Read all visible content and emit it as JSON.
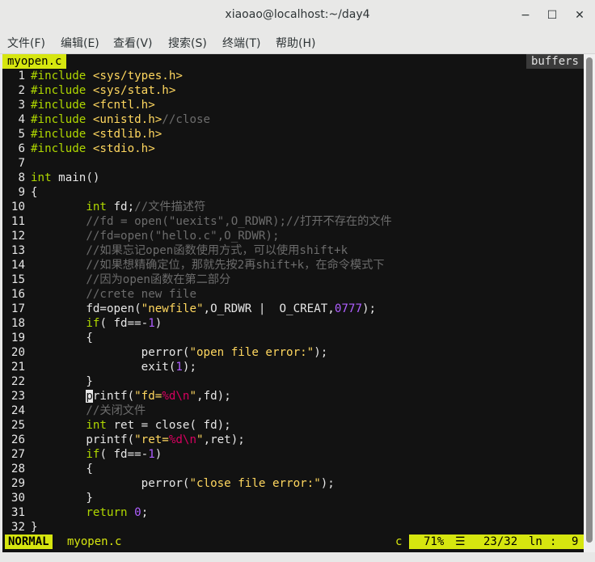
{
  "window": {
    "title": "xiaoao@localhost:~/day4",
    "minimize": "−",
    "maximize": "☐",
    "close": "✕"
  },
  "menu": [
    "文件(F)",
    "编辑(E)",
    "查看(V)",
    "搜索(S)",
    "终端(T)",
    "帮助(H)"
  ],
  "tabline": {
    "active_tab": "myopen.c",
    "buffers_label": "buffers"
  },
  "colors": {
    "keyword": "#afd700",
    "string": "#ffd75f",
    "comment": "#6c6c6c",
    "number": "#af5fff",
    "format": "#d7005f",
    "statusbar": "#d6e60f"
  },
  "code": {
    "line_numbers": [
      "1",
      "2",
      "3",
      "4",
      "5",
      "6",
      "7",
      "8",
      "9",
      "10",
      "11",
      "12",
      "13",
      "14",
      "15",
      "16",
      "17",
      "18",
      "19",
      "20",
      "21",
      "22",
      "23",
      "24",
      "25",
      "26",
      "27",
      "28",
      "29",
      "30",
      "31",
      "32"
    ],
    "lines": [
      [
        {
          "t": "#include ",
          "c": "pre"
        },
        {
          "t": "<sys/types.h>",
          "c": "inc"
        }
      ],
      [
        {
          "t": "#include ",
          "c": "pre"
        },
        {
          "t": "<sys/stat.h>",
          "c": "inc"
        }
      ],
      [
        {
          "t": "#include ",
          "c": "pre"
        },
        {
          "t": "<fcntl.h>",
          "c": "inc"
        }
      ],
      [
        {
          "t": "#include ",
          "c": "pre"
        },
        {
          "t": "<unistd.h>",
          "c": "inc"
        },
        {
          "t": "//close",
          "c": "cm"
        }
      ],
      [
        {
          "t": "#include ",
          "c": "pre"
        },
        {
          "t": "<stdlib.h>",
          "c": "inc"
        }
      ],
      [
        {
          "t": "#include ",
          "c": "pre"
        },
        {
          "t": "<stdio.h>",
          "c": "inc"
        }
      ],
      [],
      [
        {
          "t": "int",
          "c": "ty"
        },
        {
          "t": " main()",
          "c": "tx"
        }
      ],
      [
        {
          "t": "{",
          "c": "tx"
        }
      ],
      [
        {
          "t": "        ",
          "c": "tx"
        },
        {
          "t": "int",
          "c": "ty"
        },
        {
          "t": " fd;",
          "c": "tx"
        },
        {
          "t": "//文件描述符",
          "c": "cm"
        }
      ],
      [
        {
          "t": "        ",
          "c": "tx"
        },
        {
          "t": "//fd = open(\"uexits\",O_RDWR);//打开不存在的文件",
          "c": "cm"
        }
      ],
      [
        {
          "t": "        ",
          "c": "tx"
        },
        {
          "t": "//fd=open(\"hello.c\",O_RDWR);",
          "c": "cm"
        }
      ],
      [
        {
          "t": "        ",
          "c": "tx"
        },
        {
          "t": "//如果忘记open函数使用方式，可以使用shift+k",
          "c": "cm"
        }
      ],
      [
        {
          "t": "        ",
          "c": "tx"
        },
        {
          "t": "//如果想精确定位，那就先按2再shift+k，在命令模式下",
          "c": "cm"
        }
      ],
      [
        {
          "t": "        ",
          "c": "tx"
        },
        {
          "t": "//因为open函数在第二部分",
          "c": "cm"
        }
      ],
      [
        {
          "t": "        ",
          "c": "tx"
        },
        {
          "t": "//crete new file",
          "c": "cm"
        }
      ],
      [
        {
          "t": "        fd=open(",
          "c": "tx"
        },
        {
          "t": "\"newfile\"",
          "c": "st"
        },
        {
          "t": ",O_RDWR |  O_CREAT,",
          "c": "tx"
        },
        {
          "t": "0777",
          "c": "nm"
        },
        {
          "t": ");",
          "c": "tx"
        }
      ],
      [
        {
          "t": "        ",
          "c": "tx"
        },
        {
          "t": "if",
          "c": "kw"
        },
        {
          "t": "( fd==-",
          "c": "tx"
        },
        {
          "t": "1",
          "c": "nm"
        },
        {
          "t": ")",
          "c": "tx"
        }
      ],
      [
        {
          "t": "        {",
          "c": "tx"
        }
      ],
      [
        {
          "t": "                perror(",
          "c": "tx"
        },
        {
          "t": "\"open file error:\"",
          "c": "st"
        },
        {
          "t": ");",
          "c": "tx"
        }
      ],
      [
        {
          "t": "                exit(",
          "c": "tx"
        },
        {
          "t": "1",
          "c": "nm"
        },
        {
          "t": ");",
          "c": "tx"
        }
      ],
      [
        {
          "t": "        }",
          "c": "tx"
        }
      ],
      [
        {
          "t": "        ",
          "c": "tx"
        },
        {
          "t": "p",
          "c": "cur"
        },
        {
          "t": "rintf(",
          "c": "tx"
        },
        {
          "t": "\"fd=",
          "c": "st"
        },
        {
          "t": "%d\\n",
          "c": "fmt"
        },
        {
          "t": "\"",
          "c": "st"
        },
        {
          "t": ",fd);",
          "c": "tx"
        }
      ],
      [
        {
          "t": "        ",
          "c": "tx"
        },
        {
          "t": "//关闭文件",
          "c": "cm"
        }
      ],
      [
        {
          "t": "        ",
          "c": "tx"
        },
        {
          "t": "int",
          "c": "ty"
        },
        {
          "t": " ret = close( fd);",
          "c": "tx"
        }
      ],
      [
        {
          "t": "        printf(",
          "c": "tx"
        },
        {
          "t": "\"ret=",
          "c": "st"
        },
        {
          "t": "%d\\n",
          "c": "fmt"
        },
        {
          "t": "\"",
          "c": "st"
        },
        {
          "t": ",ret);",
          "c": "tx"
        }
      ],
      [
        {
          "t": "        ",
          "c": "tx"
        },
        {
          "t": "if",
          "c": "kw"
        },
        {
          "t": "( fd==-",
          "c": "tx"
        },
        {
          "t": "1",
          "c": "nm"
        },
        {
          "t": ")",
          "c": "tx"
        }
      ],
      [
        {
          "t": "        {",
          "c": "tx"
        }
      ],
      [
        {
          "t": "                perror(",
          "c": "tx"
        },
        {
          "t": "\"close file error:\"",
          "c": "st"
        },
        {
          "t": ");",
          "c": "tx"
        }
      ],
      [
        {
          "t": "        }",
          "c": "tx"
        }
      ],
      [
        {
          "t": "        ",
          "c": "tx"
        },
        {
          "t": "return",
          "c": "kw"
        },
        {
          "t": " ",
          "c": "tx"
        },
        {
          "t": "0",
          "c": "nm"
        },
        {
          "t": ";",
          "c": "tx"
        }
      ],
      [
        {
          "t": "}",
          "c": "tx"
        }
      ]
    ]
  },
  "statusline": {
    "mode": "NORMAL",
    "filename": "myopen.c",
    "filetype": "c",
    "percent": "71%",
    "menu_glyph": "☰",
    "position": "23/32",
    "ln_label": "ln",
    "separator": ":",
    "column": "9"
  }
}
